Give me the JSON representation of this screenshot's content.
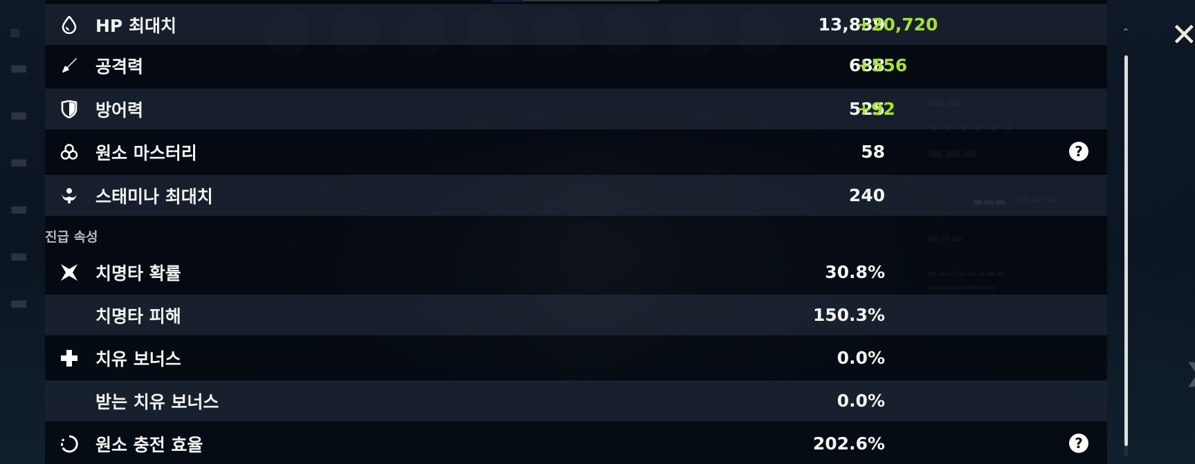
{
  "stats": [
    {
      "label": "HP 최대치",
      "value": "13,839",
      "bonus": "+20,720",
      "icon": "hp-drop-icon"
    },
    {
      "label": "공격력",
      "value": "688",
      "bonus": "+556",
      "icon": "sword-icon"
    },
    {
      "label": "방어력",
      "value": "525",
      "bonus": "+92",
      "icon": "shield-icon"
    },
    {
      "label": "원소 마스터리",
      "value": "58",
      "bonus": "",
      "icon": "elemental-mastery-icon",
      "help": "?"
    },
    {
      "label": "스태미나 최대치",
      "value": "240",
      "bonus": "",
      "icon": "stamina-icon"
    }
  ],
  "advanced_section_title": "진급 속성",
  "advanced_stats": [
    {
      "label": "치명타 확률",
      "value": "30.8%",
      "icon": "crit-rate-icon"
    },
    {
      "label": "치명타 피해",
      "value": "150.3%",
      "icon": ""
    },
    {
      "label": "치유 보너스",
      "value": "0.0%",
      "icon": "healing-cross-icon"
    },
    {
      "label": "받는 치유 보너스",
      "value": "0.0%",
      "icon": ""
    },
    {
      "label": "원소 충전 효율",
      "value": "202.6%",
      "icon": "energy-recharge-icon",
      "help": "?"
    }
  ],
  "close_glyph": "✕",
  "scroll_up_glyph": "⌃",
  "colors": {
    "bonus": "#a6e22e",
    "panel": "#04080e",
    "row_shade": "#323e52"
  }
}
